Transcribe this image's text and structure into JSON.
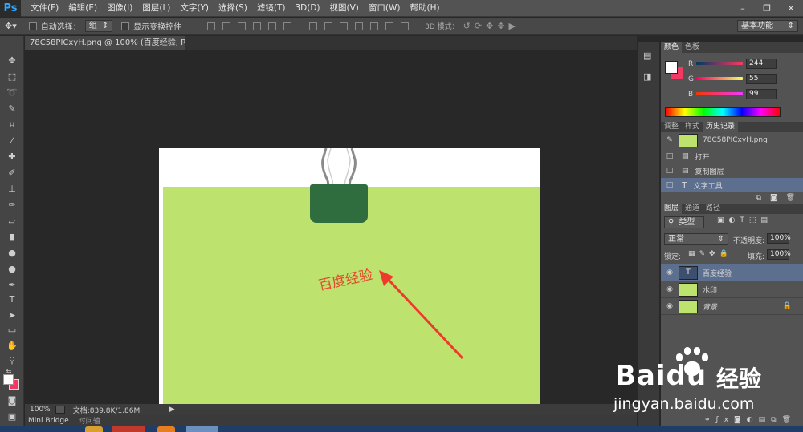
{
  "app": {
    "logo": "Ps"
  },
  "menu": [
    "文件(F)",
    "编辑(E)",
    "图像(I)",
    "图层(L)",
    "文字(Y)",
    "选择(S)",
    "滤镜(T)",
    "3D(D)",
    "视图(V)",
    "窗口(W)",
    "帮助(H)"
  ],
  "window_controls": {
    "minimize": "–",
    "restore": "❐",
    "close": "✕"
  },
  "options": {
    "auto_select_label": "自动选择：",
    "auto_select_value": "组",
    "show_transform_label": "显示变换控件",
    "mode_3d_label": "3D 模式：",
    "workspace_value": "基本功能"
  },
  "document": {
    "tab_title": "78C58PICxyH.png @ 100% (百度经验, RGB/8) *",
    "watermark_text": "百度经验",
    "canvas_color": "#bde26e"
  },
  "status": {
    "zoom": "100%",
    "doc_info": "文档:839.8K/1.86M"
  },
  "bottom_tabs": [
    "Mini Bridge",
    "时间轴"
  ],
  "color_panel": {
    "tabs": [
      "颜色",
      "色板"
    ],
    "r_label": "R",
    "r_value": "244",
    "g_label": "G",
    "g_value": "55",
    "b_label": "B",
    "b_value": "99",
    "foreground": "#f43763"
  },
  "history_panel": {
    "tabs": [
      "调整",
      "样式",
      "历史记录"
    ],
    "snapshot": "78C58PICxyH.png",
    "items": [
      "打开",
      "复制图层",
      "文字工具"
    ]
  },
  "layers_panel": {
    "tabs": [
      "图层",
      "通道",
      "路径"
    ],
    "filter_label": "类型",
    "blend_mode": "正常",
    "opacity_label": "不透明度:",
    "opacity_value": "100%",
    "lock_label": "锁定:",
    "fill_label": "填充:",
    "fill_value": "100%",
    "layers": [
      "百度经验",
      "水印",
      "背景"
    ]
  },
  "baidu_brand": {
    "logo_text": "Baidu",
    "brand_cn": "经验",
    "url": "jingyan.baidu.com"
  }
}
